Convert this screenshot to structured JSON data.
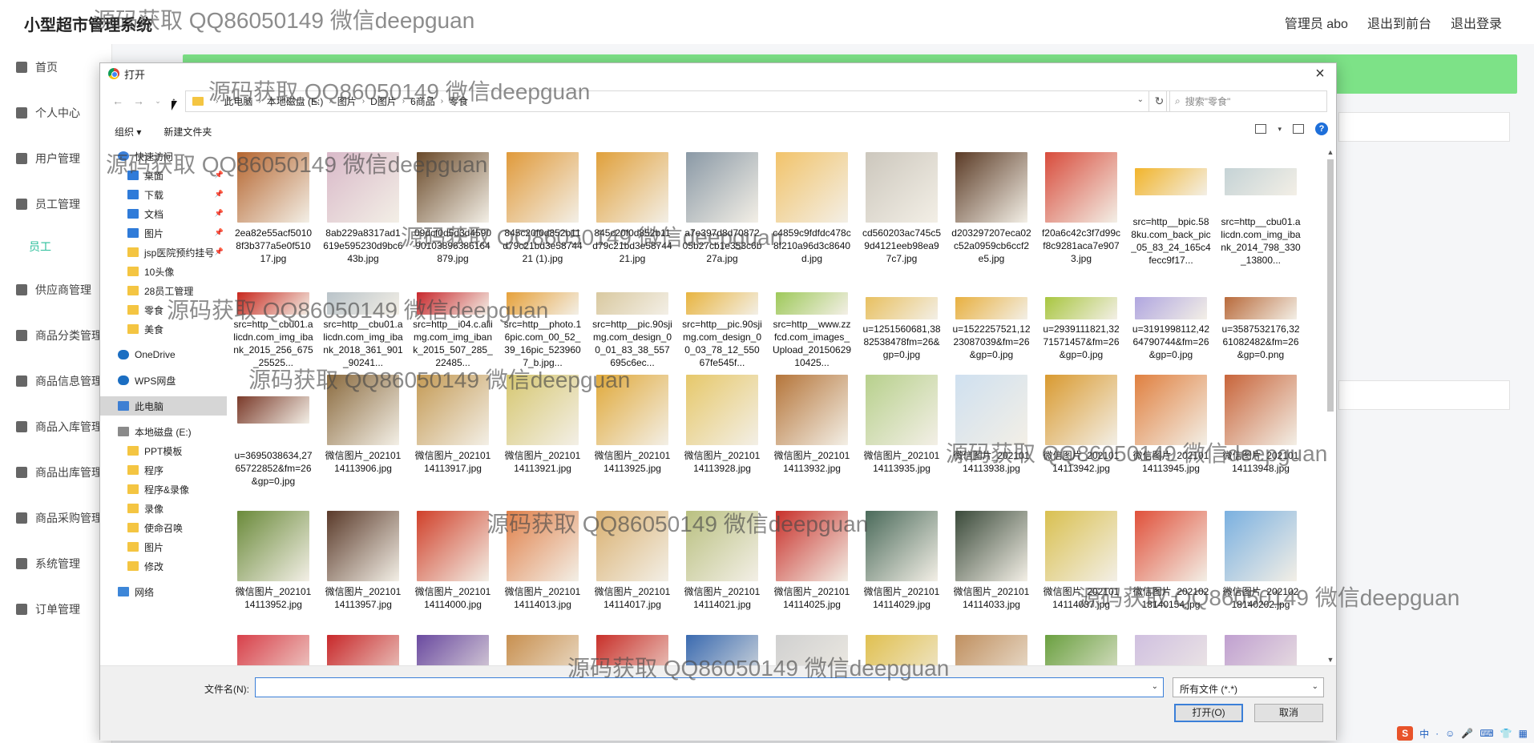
{
  "app": {
    "title": "小型超市管理系统",
    "links": [
      "管理员 abo",
      "退出到前台",
      "退出登录"
    ]
  },
  "sidebar": {
    "items": [
      {
        "label": "首页",
        "icon": "home-icon"
      },
      {
        "label": "个人中心",
        "icon": "user-icon"
      },
      {
        "label": "用户管理",
        "icon": "chart-icon"
      },
      {
        "label": "员工管理",
        "icon": "bed-icon"
      },
      {
        "label": "员工",
        "icon": "",
        "sub": true
      },
      {
        "label": "供应商管理",
        "icon": "grid-icon"
      },
      {
        "label": "商品分类管理",
        "icon": "bars-icon"
      },
      {
        "label": "商品信息管理",
        "icon": "briefcase-icon"
      },
      {
        "label": "商品入库管理",
        "icon": "clipboard-icon"
      },
      {
        "label": "商品出库管理",
        "icon": "clock-icon"
      },
      {
        "label": "商品采购管理",
        "icon": "mic-icon"
      },
      {
        "label": "系统管理",
        "icon": "monitor-icon"
      },
      {
        "label": "订单管理",
        "icon": "phone-icon"
      }
    ]
  },
  "dialog": {
    "title": "打开",
    "close": "×",
    "breadcrumb": [
      "此电脑",
      "本地磁盘 (E:)",
      "图片",
      "D图片",
      "6商品",
      "零食"
    ],
    "search_placeholder": "搜索\"零食\"",
    "organize": "组织 ▾",
    "new_folder": "新建文件夹",
    "nav": [
      {
        "label": "快速访问",
        "icon": "star",
        "pin": false
      },
      {
        "label": "桌面",
        "icon": "blue",
        "pin": true
      },
      {
        "label": "下载",
        "icon": "blue",
        "pin": true
      },
      {
        "label": "文档",
        "icon": "blue",
        "pin": true
      },
      {
        "label": "图片",
        "icon": "blue",
        "pin": true
      },
      {
        "label": "jsp医院预约挂号",
        "icon": "folder",
        "pin": true
      },
      {
        "label": "10头像",
        "icon": "folder",
        "pin": false
      },
      {
        "label": "28员工管理",
        "icon": "folder",
        "pin": false
      },
      {
        "label": "零食",
        "icon": "folder",
        "pin": false
      },
      {
        "label": "美食",
        "icon": "folder",
        "pin": false
      },
      {
        "label": "",
        "icon": "spacer",
        "pin": false
      },
      {
        "label": "OneDrive",
        "icon": "cloud",
        "pin": false
      },
      {
        "label": "",
        "icon": "spacer",
        "pin": false
      },
      {
        "label": "WPS网盘",
        "icon": "cloud",
        "pin": false
      },
      {
        "label": "",
        "icon": "spacer",
        "pin": false
      },
      {
        "label": "此电脑",
        "icon": "pc",
        "pin": false,
        "selected": true
      },
      {
        "label": "",
        "icon": "spacer",
        "pin": false
      },
      {
        "label": "本地磁盘 (E:)",
        "icon": "drive",
        "pin": false
      },
      {
        "label": "PPT模板",
        "icon": "folder",
        "pin": false
      },
      {
        "label": "程序",
        "icon": "folder",
        "pin": false
      },
      {
        "label": "程序&录像",
        "icon": "folder",
        "pin": false
      },
      {
        "label": "录像",
        "icon": "folder",
        "pin": false
      },
      {
        "label": "使命召唤",
        "icon": "folder",
        "pin": false
      },
      {
        "label": "图片",
        "icon": "folder",
        "pin": false
      },
      {
        "label": "修改",
        "icon": "folder",
        "pin": false
      },
      {
        "label": "",
        "icon": "spacer",
        "pin": false
      },
      {
        "label": "网络",
        "icon": "net",
        "pin": false
      }
    ],
    "files": [
      {
        "name": "2ea82e55acf50108f3b377a5e0f51017.jpg",
        "color": "#b5652f"
      },
      {
        "name": "8ab229a8317ad1619e595230d9bc643b.jpg",
        "color": "#d9b9c9"
      },
      {
        "name": "09dcf0d5d3d459090103896386164879.jpg",
        "color": "#6a4a2a"
      },
      {
        "name": "845c20f0d852b11d79c21bd3e5874421 (1).jpg",
        "color": "#e09a3b"
      },
      {
        "name": "845c20f0d852b11d79c21bd3e5874421.jpg",
        "color": "#e0a03b"
      },
      {
        "name": "a7e397d8d7087205b27cb1e353c6b27a.jpg",
        "color": "#8a99a6"
      },
      {
        "name": "c4859c9fdfdc478c8f210a96d3c8640d.jpg",
        "color": "#f2c36a"
      },
      {
        "name": "cd560203ac745c59d4121eeb98ea97c7.jpg",
        "color": "#ccc7bd"
      },
      {
        "name": "d203297207eca02c52a0959cb6ccf2e5.jpg",
        "color": "#5b3b26"
      },
      {
        "name": "f20a6c42c3f7d99cf8c9281aca7e9073.jpg",
        "color": "#d84c3c"
      },
      {
        "name": "src=http__bpic.588ku.com_back_pic_05_83_24_165c4fecc9f17...",
        "color": "#f2b42b"
      },
      {
        "name": "src=http__cbu01.alicdn.com_img_ibank_2014_798_330_13800...",
        "color": "#c5d3d6"
      },
      {
        "name": "src=http__cbu01.alicdn.com_img_ibank_2015_256_675_25525...",
        "color": "#c8281e"
      },
      {
        "name": "src=http__cbu01.alicdn.com_img_ibank_2018_361_901_90241...",
        "color": "#b9c3c9"
      },
      {
        "name": "src=http__i04.c.aliimg.com_img_ibank_2015_507_285_22485...",
        "color": "#c8282d"
      },
      {
        "name": "src=http__photo.16pic.com_00_52_39_16pic_5239607_b.jpg...",
        "color": "#e6a13b"
      },
      {
        "name": "src=http__pic.90sjimg.com_design_00_01_83_38_557695c6ec...",
        "color": "#d9c9a0"
      },
      {
        "name": "src=http__pic.90sjimg.com_design_00_03_78_12_55067fe545f...",
        "color": "#e8b440"
      },
      {
        "name": "src=http__www.zzfcd.com_images_Upload_2015062910425...",
        "color": "#9ec95a"
      },
      {
        "name": "u=1251560681,3882538478fm=26&gp=0.jpg",
        "color": "#e8c060"
      },
      {
        "name": "u=1522257521,1223087039&fm=26&gp=0.jpg",
        "color": "#e8b040"
      },
      {
        "name": "u=2939111821,3271571457&fm=26&gp=0.jpg",
        "color": "#a8c640"
      },
      {
        "name": "u=3191998112,4264790744&fm=26&gp=0.jpg",
        "color": "#b0a6e0"
      },
      {
        "name": "u=3587532176,3261082482&fm=26&gp=0.png",
        "color": "#b86a3b"
      },
      {
        "name": "u=3695038634,2765722852&fm=26&gp=0.jpg",
        "color": "#7a3a2a"
      },
      {
        "name": "微信图片_20210114113906.jpg",
        "color": "#8a6a3e"
      },
      {
        "name": "微信图片_20210114113917.jpg",
        "color": "#c49a54"
      },
      {
        "name": "微信图片_20210114113921.jpg",
        "color": "#d6c770"
      },
      {
        "name": "微信图片_20210114113925.jpg",
        "color": "#e0a93a"
      },
      {
        "name": "微信图片_20210114113928.jpg",
        "color": "#e6c86a"
      },
      {
        "name": "微信图片_20210114113932.jpg",
        "color": "#b5753a"
      },
      {
        "name": "微信图片_20210114113935.jpg",
        "color": "#b7d08c"
      },
      {
        "name": "微信图片_20210114113938.jpg",
        "color": "#cfe0f0"
      },
      {
        "name": "微信图片_20210114113942.jpg",
        "color": "#d99a30"
      },
      {
        "name": "微信图片_20210114113945.jpg",
        "color": "#e08040"
      },
      {
        "name": "微信图片_20210114113948.jpg",
        "color": "#c8643a"
      },
      {
        "name": "微信图片_20210114113952.jpg",
        "color": "#6a8a3a"
      },
      {
        "name": "微信图片_20210114113957.jpg",
        "color": "#5a3a2a"
      },
      {
        "name": "微信图片_20210114114000.jpg",
        "color": "#d0402a"
      },
      {
        "name": "微信图片_20210114114013.jpg",
        "color": "#e0804a"
      },
      {
        "name": "微信图片_20210114114017.jpg",
        "color": "#d9b070"
      },
      {
        "name": "微信图片_20210114114021.jpg",
        "color": "#b9c080"
      },
      {
        "name": "微信图片_20210114114025.jpg",
        "color": "#c8302a"
      },
      {
        "name": "微信图片_20210114114029.jpg",
        "color": "#4a6a5a"
      },
      {
        "name": "微信图片_20210114114033.jpg",
        "color": "#3a4a3a"
      },
      {
        "name": "微信图片_20210114114037.jpg",
        "color": "#d9c050"
      },
      {
        "name": "微信图片_20210218140154.jpg",
        "color": "#e0503a"
      },
      {
        "name": "微信图片_20210218140202.jpg",
        "color": "#7ab0e0"
      },
      {
        "name": "",
        "color": "#d8404a"
      },
      {
        "name": "",
        "color": "#c8282a"
      },
      {
        "name": "",
        "color": "#6a4aa0"
      },
      {
        "name": "",
        "color": "#c89050"
      },
      {
        "name": "",
        "color": "#c8302a"
      },
      {
        "name": "",
        "color": "#3a6ab0"
      },
      {
        "name": "",
        "color": "#d0d0d0"
      },
      {
        "name": "",
        "color": "#e0c050"
      },
      {
        "name": "",
        "color": "#c09060"
      },
      {
        "name": "",
        "color": "#6aa040"
      },
      {
        "name": "",
        "color": "#d0c0e0"
      },
      {
        "name": "",
        "color": "#c0a0d0"
      }
    ],
    "filename_label": "文件名(N):",
    "filename_value": "",
    "filter": "所有文件 (*.*)",
    "open_button": "打开(O)",
    "cancel_button": "取消"
  },
  "watermark": "源码获取 QQ86050149 微信deepguan",
  "tray": [
    "中",
    "·",
    "☺",
    "🎤",
    "⌨",
    "👕",
    "▦"
  ]
}
